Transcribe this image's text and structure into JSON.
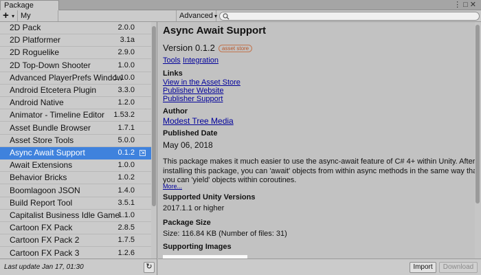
{
  "window": {
    "tab_title": "Package Manager",
    "menu_icon": "kebab-menu-icon",
    "maximize_icon": "maximize-icon",
    "close_icon": "close-icon"
  },
  "toolbar": {
    "add_label": "+",
    "source_dropdown": "My Assets",
    "advanced_dropdown": "Advanced",
    "search_value": "",
    "search_icon": "search-icon"
  },
  "packages": [
    {
      "name": "2D Pack",
      "version": "2.0.0"
    },
    {
      "name": "2D Platformer",
      "version": "3.1a"
    },
    {
      "name": "2D Roguelike",
      "version": "2.9.0"
    },
    {
      "name": "2D Top-Down Shooter",
      "version": "1.0.0"
    },
    {
      "name": "Advanced PlayerPrefs Window",
      "version": "1.10.0"
    },
    {
      "name": "Android Etcetera Plugin",
      "version": "3.3.0"
    },
    {
      "name": "Android Native",
      "version": "1.2.0"
    },
    {
      "name": "Animator - Timeline Editor",
      "version": "1.53.2"
    },
    {
      "name": "Asset Bundle Browser",
      "version": "1.7.1"
    },
    {
      "name": "Asset Store Tools",
      "version": "5.0.0"
    },
    {
      "name": "Async Await Support",
      "version": "0.1.2",
      "selected": true
    },
    {
      "name": "Await Extensions",
      "version": "1.0.0"
    },
    {
      "name": "Behavior Bricks",
      "version": "1.0.2"
    },
    {
      "name": "Boomlagoon JSON",
      "version": "1.4.0"
    },
    {
      "name": "Build Report Tool",
      "version": "3.5.1"
    },
    {
      "name": "Capitalist Business Idle Game",
      "version": "1.1.0"
    },
    {
      "name": "Cartoon FX Pack",
      "version": "2.8.5"
    },
    {
      "name": "Cartoon FX Pack 2",
      "version": "1.7.5"
    },
    {
      "name": "Cartoon FX Pack 3",
      "version": "1.2.6"
    }
  ],
  "list_footer": {
    "last_update": "Last update Jan 17, 01:30",
    "refresh_icon": "refresh-icon"
  },
  "detail": {
    "title": "Async Await Support",
    "version": "Version 0.1.2",
    "badge": "asset store",
    "categories": [
      "Tools",
      "Integration"
    ],
    "links_heading": "Links",
    "links": [
      "View in the Asset Store",
      "Publisher Website",
      "Publisher Support"
    ],
    "author_heading": "Author",
    "author": "Modest Tree Media",
    "published_heading": "Published Date",
    "published_date": "May 06,  2018",
    "description": "This package makes it much easier to use the async-await feature of C# 4+ within Unity. After installing this package, you can 'await' objects from within async methods in the same way that you can 'yield' objects within coroutines.",
    "more": "More...",
    "unity_heading": "Supported Unity Versions",
    "unity_versions": "2017.1.1 or higher",
    "size_heading": "Package Size",
    "size": "Size: 116.84 KB (Number of files: 31)",
    "images_heading": "Supporting Images"
  },
  "actions": {
    "import": "Import",
    "download": "Download"
  }
}
